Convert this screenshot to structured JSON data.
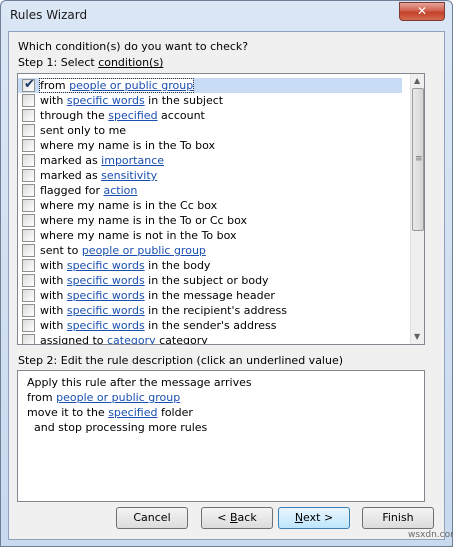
{
  "window": {
    "title": "Rules Wizard",
    "close_glyph": "✕"
  },
  "prompt": "Which condition(s) do you want to check?",
  "step1": {
    "pre": "Step 1: Select ",
    "link": "condition(s)"
  },
  "conditions": [
    {
      "checked": true,
      "parts": [
        [
          "from ",
          false
        ],
        [
          "people or public group",
          true
        ]
      ]
    },
    {
      "checked": false,
      "parts": [
        [
          "with ",
          false
        ],
        [
          "specific words",
          true
        ],
        [
          " in the subject",
          false
        ]
      ]
    },
    {
      "checked": false,
      "parts": [
        [
          "through the ",
          false
        ],
        [
          "specified",
          true
        ],
        [
          " account",
          false
        ]
      ]
    },
    {
      "checked": false,
      "parts": [
        [
          "sent only to me",
          false
        ]
      ]
    },
    {
      "checked": false,
      "parts": [
        [
          "where my name is in the To box",
          false
        ]
      ]
    },
    {
      "checked": false,
      "parts": [
        [
          "marked as ",
          false
        ],
        [
          "importance",
          true
        ]
      ]
    },
    {
      "checked": false,
      "parts": [
        [
          "marked as ",
          false
        ],
        [
          "sensitivity",
          true
        ]
      ]
    },
    {
      "checked": false,
      "parts": [
        [
          "flagged for ",
          false
        ],
        [
          "action",
          true
        ]
      ]
    },
    {
      "checked": false,
      "parts": [
        [
          "where my name is in the Cc box",
          false
        ]
      ]
    },
    {
      "checked": false,
      "parts": [
        [
          "where my name is in the To or Cc box",
          false
        ]
      ]
    },
    {
      "checked": false,
      "parts": [
        [
          "where my name is not in the To box",
          false
        ]
      ]
    },
    {
      "checked": false,
      "parts": [
        [
          "sent to ",
          false
        ],
        [
          "people or public group",
          true
        ]
      ]
    },
    {
      "checked": false,
      "parts": [
        [
          "with ",
          false
        ],
        [
          "specific words",
          true
        ],
        [
          " in the body",
          false
        ]
      ]
    },
    {
      "checked": false,
      "parts": [
        [
          "with ",
          false
        ],
        [
          "specific words",
          true
        ],
        [
          " in the subject or body",
          false
        ]
      ]
    },
    {
      "checked": false,
      "parts": [
        [
          "with ",
          false
        ],
        [
          "specific words",
          true
        ],
        [
          " in the message header",
          false
        ]
      ]
    },
    {
      "checked": false,
      "parts": [
        [
          "with ",
          false
        ],
        [
          "specific words",
          true
        ],
        [
          " in the recipient's address",
          false
        ]
      ]
    },
    {
      "checked": false,
      "parts": [
        [
          "with ",
          false
        ],
        [
          "specific words",
          true
        ],
        [
          " in the sender's address",
          false
        ]
      ]
    },
    {
      "checked": false,
      "parts": [
        [
          "assigned to ",
          false
        ],
        [
          "category",
          true
        ],
        [
          " category",
          false
        ]
      ]
    }
  ],
  "step2": {
    "label": "Step 2: Edit the rule description (click an underlined value)"
  },
  "description": [
    [
      [
        "Apply this rule after the message arrives",
        false
      ]
    ],
    [
      [
        "from ",
        false
      ],
      [
        "people or public group",
        true
      ]
    ],
    [
      [
        "move it to the ",
        false
      ],
      [
        "specified",
        true
      ],
      [
        " folder",
        false
      ]
    ],
    [
      [
        "  and stop processing more rules",
        false
      ]
    ]
  ],
  "buttons": {
    "cancel": "Cancel",
    "back_pre": "< ",
    "back_u": "B",
    "back_post": "ack",
    "next_u": "N",
    "next_post": "ext >",
    "finish": "Finish"
  },
  "scrollbar": {
    "up_icon": "▲",
    "down_icon": "▼",
    "grip_icon": "≡"
  },
  "watermark": "wsxdn.com"
}
